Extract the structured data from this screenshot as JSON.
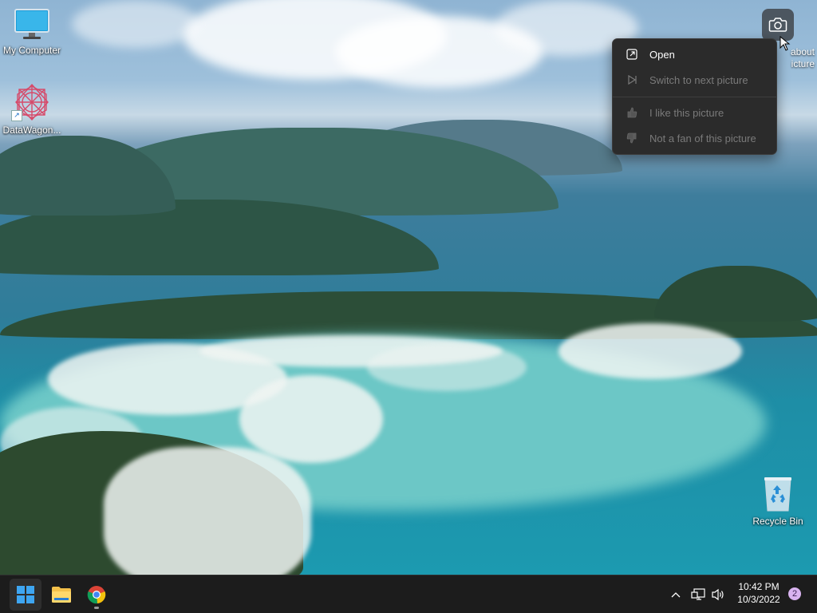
{
  "desktop": {
    "icons": [
      {
        "label": "My Computer"
      },
      {
        "label": "DataWagon..."
      },
      {
        "label": "Recycle Bin"
      }
    ]
  },
  "spotlight": {
    "about_label_line1": "about",
    "about_label_line2": "icture",
    "menu": [
      {
        "label": "Open",
        "enabled": true,
        "icon": "open-external-icon"
      },
      {
        "label": "Switch to next picture",
        "enabled": false,
        "icon": "next-picture-icon"
      },
      {
        "label": "I like this picture",
        "enabled": false,
        "icon": "thumbs-up-icon"
      },
      {
        "label": "Not a fan of this picture",
        "enabled": false,
        "icon": "thumbs-down-icon"
      }
    ]
  },
  "taskbar": {
    "pinned": [
      "start",
      "file-explorer",
      "chrome"
    ],
    "clock": {
      "time": "10:42 PM",
      "date": "10/3/2022"
    },
    "notification_count": "2"
  },
  "colors": {
    "taskbar_bg": "#1c1c1c",
    "menu_bg": "#2b2b2b",
    "windows_blue": "#3ea6f2"
  }
}
